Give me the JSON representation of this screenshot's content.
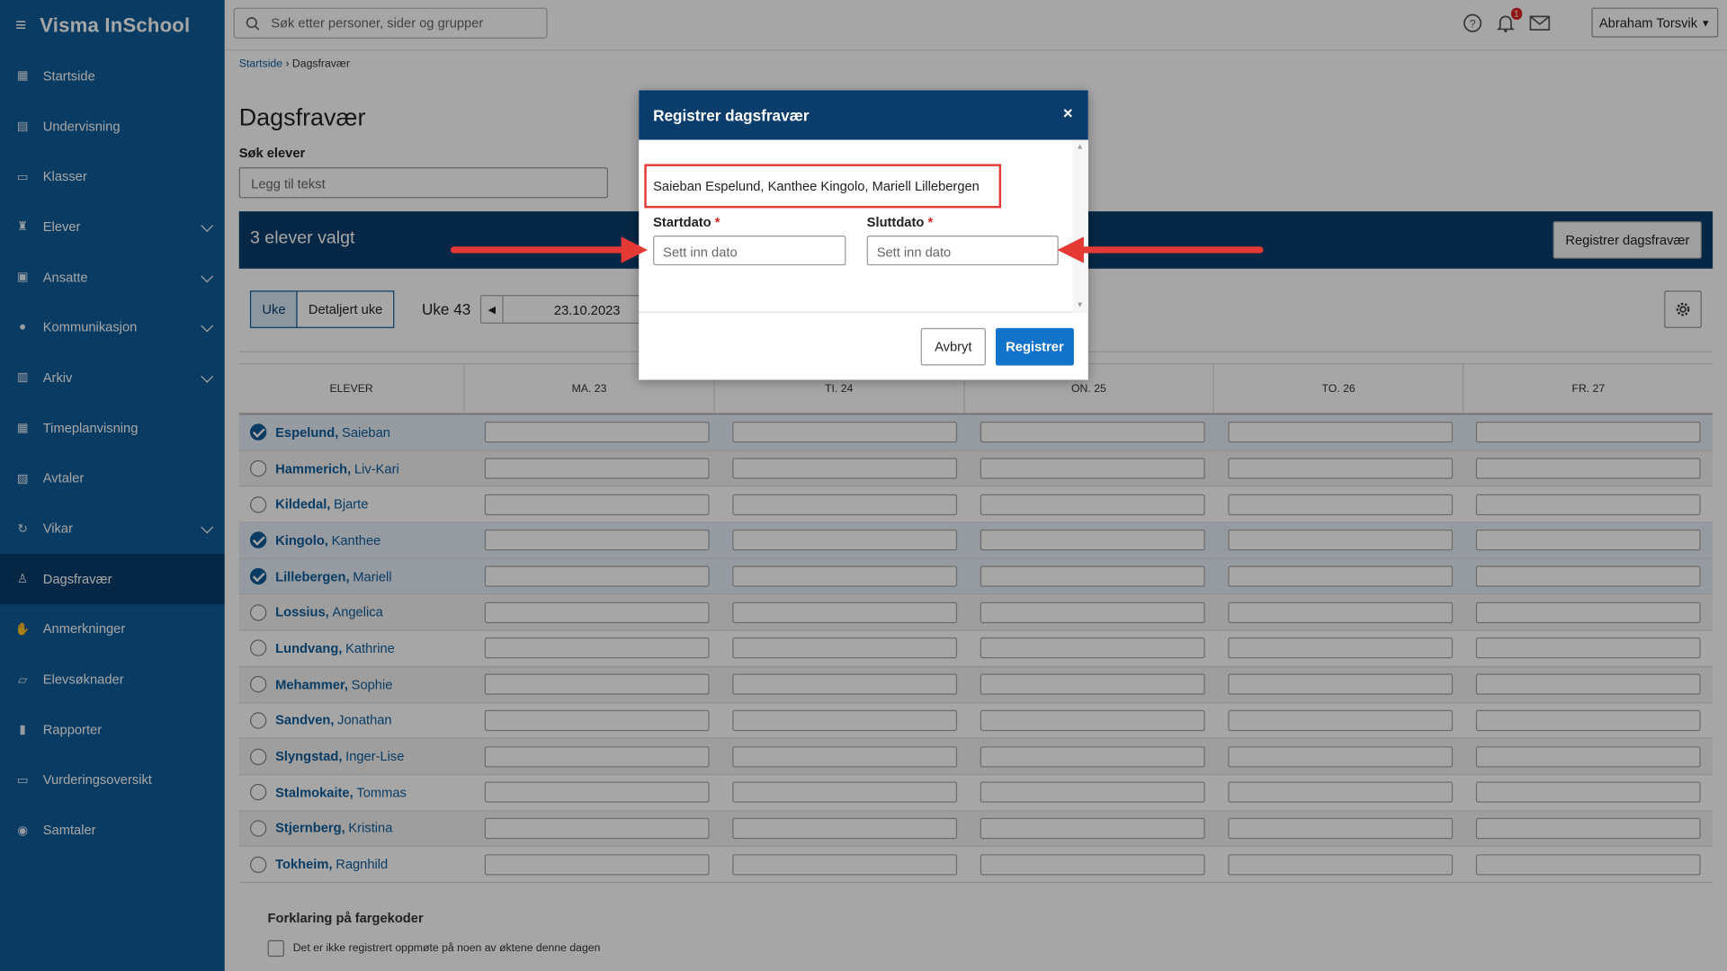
{
  "app": {
    "title": "Visma InSchool"
  },
  "sidebar": {
    "items": [
      {
        "label": "Startside",
        "icon": "grid-icon"
      },
      {
        "label": "Undervisning",
        "icon": "book-icon"
      },
      {
        "label": "Klasser",
        "icon": "class-icon"
      },
      {
        "label": "Elever",
        "icon": "student-icon",
        "expandable": true
      },
      {
        "label": "Ansatte",
        "icon": "briefcase-icon",
        "expandable": true
      },
      {
        "label": "Kommunikasjon",
        "icon": "chat-icon",
        "expandable": true
      },
      {
        "label": "Arkiv",
        "icon": "archive-icon",
        "expandable": true
      },
      {
        "label": "Timeplanvisning",
        "icon": "calendar-icon"
      },
      {
        "label": "Avtaler",
        "icon": "calendar-check-icon"
      },
      {
        "label": "Vikar",
        "icon": "refresh-icon",
        "expandable": true
      },
      {
        "label": "Dagsfravær",
        "icon": "user-check-icon",
        "active": true
      },
      {
        "label": "Anmerkninger",
        "icon": "hand-icon"
      },
      {
        "label": "Elevsøknader",
        "icon": "inbox-icon"
      },
      {
        "label": "Rapporter",
        "icon": "chart-icon"
      },
      {
        "label": "Vurderingsoversikt",
        "icon": "assessment-icon"
      },
      {
        "label": "Samtaler",
        "icon": "conversation-icon"
      }
    ]
  },
  "topbar": {
    "search_placeholder": "Søk etter personer, sider og grupper",
    "notification_count": "1",
    "user": "Abraham Torsvik"
  },
  "breadcrumb": {
    "home": "Startside",
    "current": "Dagsfravær"
  },
  "page": {
    "title": "Dagsfravær",
    "search_label": "Søk elever",
    "search_placeholder": "Legg til tekst",
    "selected_text": "3 elever valgt",
    "register_button": "Registrer dagsfravær",
    "view_week": "Uke",
    "view_detail": "Detaljert uke",
    "week": "Uke 43",
    "date": "23.10.2023"
  },
  "grid": {
    "student_header": "ELEVER",
    "days": [
      "MA. 23",
      "TI. 24",
      "ON. 25",
      "TO. 26",
      "FR. 27"
    ],
    "students": [
      {
        "last": "Espelund,",
        "first": "Saieban",
        "checked": true
      },
      {
        "last": "Hammerich,",
        "first": "Liv-Kari",
        "checked": false
      },
      {
        "last": "Kildedal,",
        "first": "Bjarte",
        "checked": false
      },
      {
        "last": "Kingolo,",
        "first": "Kanthee",
        "checked": true
      },
      {
        "last": "Lillebergen,",
        "first": "Mariell",
        "checked": true
      },
      {
        "last": "Lossius,",
        "first": "Angelica",
        "checked": false
      },
      {
        "last": "Lundvang,",
        "first": "Kathrine",
        "checked": false
      },
      {
        "last": "Mehammer,",
        "first": "Sophie",
        "checked": false
      },
      {
        "last": "Sandven,",
        "first": "Jonathan",
        "checked": false
      },
      {
        "last": "Slyngstad,",
        "first": "Inger-Lise",
        "checked": false
      },
      {
        "last": "Stalmokaite,",
        "first": "Tommas",
        "checked": false
      },
      {
        "last": "Stjernberg,",
        "first": "Kristina",
        "checked": false
      },
      {
        "last": "Tokheim,",
        "first": "Ragnhild",
        "checked": false
      }
    ]
  },
  "legend": {
    "title": "Forklaring på fargekoder",
    "item1": "Det er ikke registrert oppmøte på noen av øktene denne dagen"
  },
  "modal": {
    "title": "Registrer dagsfravær",
    "close": "×",
    "selected_names": "Saieban Espelund, Kanthee Kingolo, Mariell Lillebergen",
    "start_label": "Startdato",
    "end_label": "Sluttdato",
    "required_mark": "*",
    "date_placeholder": "Sett inn dato",
    "cancel": "Avbryt",
    "submit": "Registrer"
  },
  "colors": {
    "sidebar": "#0e5b99",
    "accent": "#1173c9",
    "annotation": "#e53935"
  }
}
